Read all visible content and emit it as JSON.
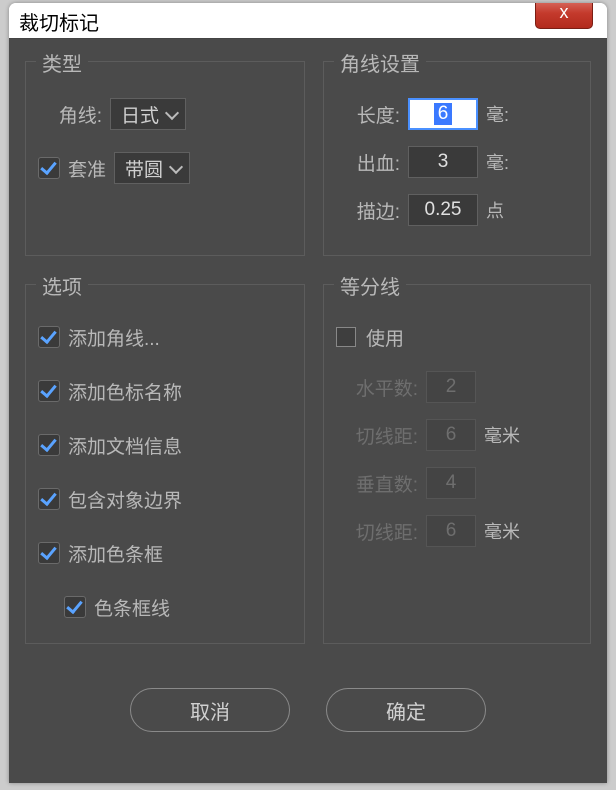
{
  "title": "裁切标记",
  "close": "x",
  "type_group": {
    "legend": "类型",
    "corner_label": "角线:",
    "corner_value": "日式",
    "reg_label": "套准",
    "reg_value": "带圆"
  },
  "corner_settings": {
    "legend": "角线设置",
    "length_label": "长度:",
    "length_value": "6",
    "length_unit": "毫:",
    "bleed_label": "出血:",
    "bleed_value": "3",
    "bleed_unit": "毫:",
    "stroke_label": "描边:",
    "stroke_value": "0.25",
    "stroke_unit": "点"
  },
  "options": {
    "legend": "选项",
    "items": [
      "添加角线...",
      "添加色标名称",
      "添加文档信息",
      "包含对象边界",
      "添加色条框",
      "色条框线"
    ]
  },
  "divisions": {
    "legend": "等分线",
    "use_label": "使用",
    "h_count_label": "水平数:",
    "h_count_value": "2",
    "h_dist_label": "切线距:",
    "h_dist_value": "6",
    "h_dist_unit": "毫米",
    "v_count_label": "垂直数:",
    "v_count_value": "4",
    "v_dist_label": "切线距:",
    "v_dist_value": "6",
    "v_dist_unit": "毫米"
  },
  "buttons": {
    "cancel": "取消",
    "ok": "确定"
  }
}
